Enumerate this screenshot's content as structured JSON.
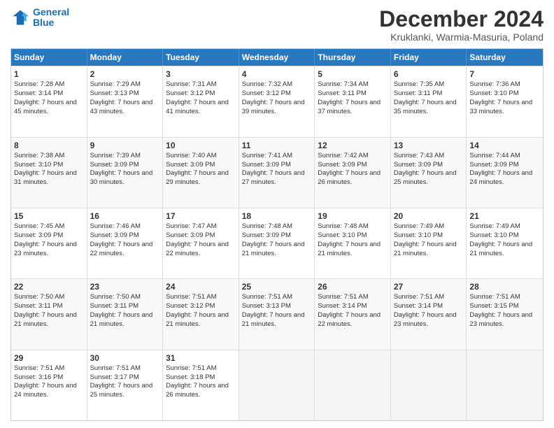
{
  "logo": {
    "line1": "General",
    "line2": "Blue"
  },
  "title": "December 2024",
  "subtitle": "Kruklanki, Warmia-Masuria, Poland",
  "days": [
    "Sunday",
    "Monday",
    "Tuesday",
    "Wednesday",
    "Thursday",
    "Friday",
    "Saturday"
  ],
  "rows": [
    [
      {
        "day": "1",
        "sunrise": "Sunrise: 7:28 AM",
        "sunset": "Sunset: 3:14 PM",
        "daylight": "Daylight: 7 hours and 45 minutes."
      },
      {
        "day": "2",
        "sunrise": "Sunrise: 7:29 AM",
        "sunset": "Sunset: 3:13 PM",
        "daylight": "Daylight: 7 hours and 43 minutes."
      },
      {
        "day": "3",
        "sunrise": "Sunrise: 7:31 AM",
        "sunset": "Sunset: 3:12 PM",
        "daylight": "Daylight: 7 hours and 41 minutes."
      },
      {
        "day": "4",
        "sunrise": "Sunrise: 7:32 AM",
        "sunset": "Sunset: 3:12 PM",
        "daylight": "Daylight: 7 hours and 39 minutes."
      },
      {
        "day": "5",
        "sunrise": "Sunrise: 7:34 AM",
        "sunset": "Sunset: 3:11 PM",
        "daylight": "Daylight: 7 hours and 37 minutes."
      },
      {
        "day": "6",
        "sunrise": "Sunrise: 7:35 AM",
        "sunset": "Sunset: 3:11 PM",
        "daylight": "Daylight: 7 hours and 35 minutes."
      },
      {
        "day": "7",
        "sunrise": "Sunrise: 7:36 AM",
        "sunset": "Sunset: 3:10 PM",
        "daylight": "Daylight: 7 hours and 33 minutes."
      }
    ],
    [
      {
        "day": "8",
        "sunrise": "Sunrise: 7:38 AM",
        "sunset": "Sunset: 3:10 PM",
        "daylight": "Daylight: 7 hours and 31 minutes."
      },
      {
        "day": "9",
        "sunrise": "Sunrise: 7:39 AM",
        "sunset": "Sunset: 3:09 PM",
        "daylight": "Daylight: 7 hours and 30 minutes."
      },
      {
        "day": "10",
        "sunrise": "Sunrise: 7:40 AM",
        "sunset": "Sunset: 3:09 PM",
        "daylight": "Daylight: 7 hours and 29 minutes."
      },
      {
        "day": "11",
        "sunrise": "Sunrise: 7:41 AM",
        "sunset": "Sunset: 3:09 PM",
        "daylight": "Daylight: 7 hours and 27 minutes."
      },
      {
        "day": "12",
        "sunrise": "Sunrise: 7:42 AM",
        "sunset": "Sunset: 3:09 PM",
        "daylight": "Daylight: 7 hours and 26 minutes."
      },
      {
        "day": "13",
        "sunrise": "Sunrise: 7:43 AM",
        "sunset": "Sunset: 3:09 PM",
        "daylight": "Daylight: 7 hours and 25 minutes."
      },
      {
        "day": "14",
        "sunrise": "Sunrise: 7:44 AM",
        "sunset": "Sunset: 3:09 PM",
        "daylight": "Daylight: 7 hours and 24 minutes."
      }
    ],
    [
      {
        "day": "15",
        "sunrise": "Sunrise: 7:45 AM",
        "sunset": "Sunset: 3:09 PM",
        "daylight": "Daylight: 7 hours and 23 minutes."
      },
      {
        "day": "16",
        "sunrise": "Sunrise: 7:46 AM",
        "sunset": "Sunset: 3:09 PM",
        "daylight": "Daylight: 7 hours and 22 minutes."
      },
      {
        "day": "17",
        "sunrise": "Sunrise: 7:47 AM",
        "sunset": "Sunset: 3:09 PM",
        "daylight": "Daylight: 7 hours and 22 minutes."
      },
      {
        "day": "18",
        "sunrise": "Sunrise: 7:48 AM",
        "sunset": "Sunset: 3:09 PM",
        "daylight": "Daylight: 7 hours and 21 minutes."
      },
      {
        "day": "19",
        "sunrise": "Sunrise: 7:48 AM",
        "sunset": "Sunset: 3:10 PM",
        "daylight": "Daylight: 7 hours and 21 minutes."
      },
      {
        "day": "20",
        "sunrise": "Sunrise: 7:49 AM",
        "sunset": "Sunset: 3:10 PM",
        "daylight": "Daylight: 7 hours and 21 minutes."
      },
      {
        "day": "21",
        "sunrise": "Sunrise: 7:49 AM",
        "sunset": "Sunset: 3:10 PM",
        "daylight": "Daylight: 7 hours and 21 minutes."
      }
    ],
    [
      {
        "day": "22",
        "sunrise": "Sunrise: 7:50 AM",
        "sunset": "Sunset: 3:11 PM",
        "daylight": "Daylight: 7 hours and 21 minutes."
      },
      {
        "day": "23",
        "sunrise": "Sunrise: 7:50 AM",
        "sunset": "Sunset: 3:11 PM",
        "daylight": "Daylight: 7 hours and 21 minutes."
      },
      {
        "day": "24",
        "sunrise": "Sunrise: 7:51 AM",
        "sunset": "Sunset: 3:12 PM",
        "daylight": "Daylight: 7 hours and 21 minutes."
      },
      {
        "day": "25",
        "sunrise": "Sunrise: 7:51 AM",
        "sunset": "Sunset: 3:13 PM",
        "daylight": "Daylight: 7 hours and 21 minutes."
      },
      {
        "day": "26",
        "sunrise": "Sunrise: 7:51 AM",
        "sunset": "Sunset: 3:14 PM",
        "daylight": "Daylight: 7 hours and 22 minutes."
      },
      {
        "day": "27",
        "sunrise": "Sunrise: 7:51 AM",
        "sunset": "Sunset: 3:14 PM",
        "daylight": "Daylight: 7 hours and 23 minutes."
      },
      {
        "day": "28",
        "sunrise": "Sunrise: 7:51 AM",
        "sunset": "Sunset: 3:15 PM",
        "daylight": "Daylight: 7 hours and 23 minutes."
      }
    ],
    [
      {
        "day": "29",
        "sunrise": "Sunrise: 7:51 AM",
        "sunset": "Sunset: 3:16 PM",
        "daylight": "Daylight: 7 hours and 24 minutes."
      },
      {
        "day": "30",
        "sunrise": "Sunrise: 7:51 AM",
        "sunset": "Sunset: 3:17 PM",
        "daylight": "Daylight: 7 hours and 25 minutes."
      },
      {
        "day": "31",
        "sunrise": "Sunrise: 7:51 AM",
        "sunset": "Sunset: 3:18 PM",
        "daylight": "Daylight: 7 hours and 26 minutes."
      },
      null,
      null,
      null,
      null
    ]
  ]
}
